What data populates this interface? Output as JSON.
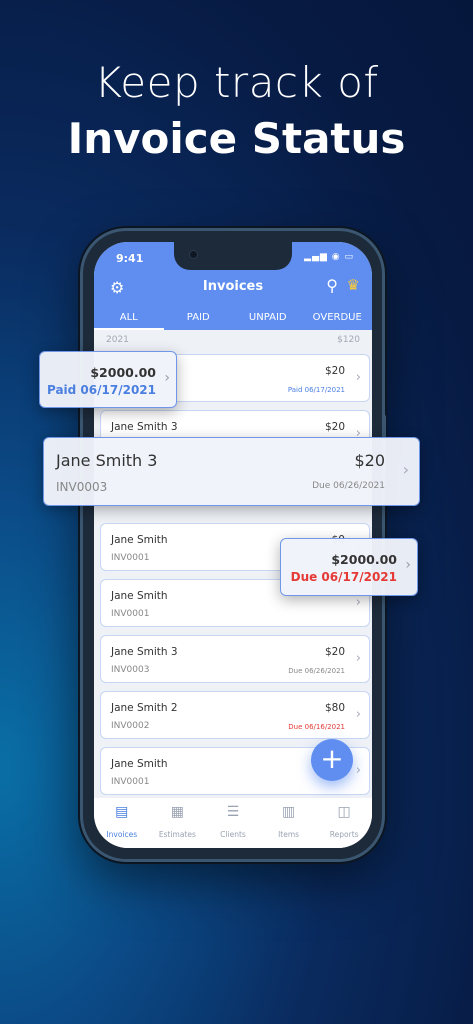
{
  "headline": {
    "line1": "Keep track of",
    "line2": "Invoice Status"
  },
  "status_bar": {
    "time": "9:41",
    "icons": "▂▄▆ ◉ ▭"
  },
  "app": {
    "title": "Invoices",
    "tabs": [
      "ALL",
      "PAID",
      "UNPAID",
      "OVERDUE"
    ],
    "active_tab": "ALL",
    "list_header": {
      "year": "2021",
      "total": "$120"
    },
    "invoices": [
      {
        "name": "",
        "number": "",
        "amount": "$20",
        "status": "Paid 06/17/2021",
        "status_type": "paid"
      },
      {
        "name": "Jane Smith 3",
        "number": "",
        "amount": "$20",
        "status": "",
        "status_type": ""
      },
      {
        "name": "Jane Smith",
        "number": "INV0001",
        "amount": "$0",
        "status": "",
        "status_type": ""
      },
      {
        "name": "Jane Smith",
        "number": "INV0001",
        "amount": "",
        "status": "",
        "status_type": ""
      },
      {
        "name": "Jane Smith 3",
        "number": "INV0003",
        "amount": "$20",
        "status": "Due 06/26/2021",
        "status_type": "due"
      },
      {
        "name": "Jane Smith 2",
        "number": "INV0002",
        "amount": "$80",
        "status": "Due 06/16/2021",
        "status_type": "overdue"
      },
      {
        "name": "Jane Smith",
        "number": "INV0001",
        "amount": "",
        "status": "",
        "status_type": ""
      }
    ],
    "bottom_nav": [
      {
        "label": "Invoices",
        "icon": "invoice-icon",
        "active": true
      },
      {
        "label": "Estimates",
        "icon": "calculator-icon",
        "active": false
      },
      {
        "label": "Clients",
        "icon": "clients-icon",
        "active": false
      },
      {
        "label": "Items",
        "icon": "barcode-icon",
        "active": false
      },
      {
        "label": "Reports",
        "icon": "chart-icon",
        "active": false
      }
    ]
  },
  "callouts": {
    "paid": {
      "amount": "$2000.00",
      "status": "Paid 06/17/2021"
    },
    "featured": {
      "name": "Jane Smith 3",
      "number": "INV0003",
      "amount": "$20",
      "status": "Due 06/26/2021"
    },
    "overdue": {
      "amount": "$2000.00",
      "status": "Due 06/17/2021"
    }
  },
  "colors": {
    "accent": "#5f8ef0",
    "paid": "#4a7fe0",
    "overdue": "#e53935",
    "crown": "#f5c842"
  }
}
